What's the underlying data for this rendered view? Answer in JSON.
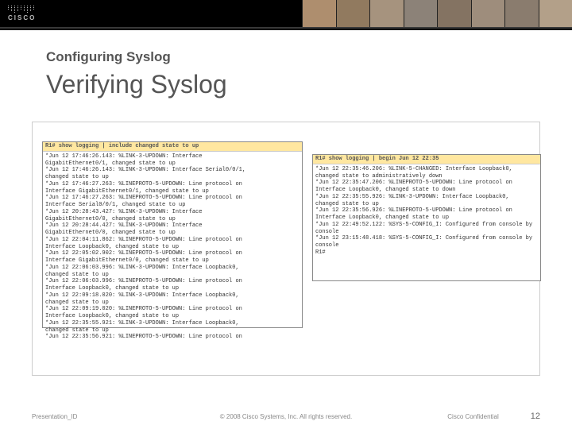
{
  "header": {
    "logo_text": "CISCO"
  },
  "heading": {
    "subtitle": "Configuring Syslog",
    "title": "Verifying Syslog"
  },
  "terminal_left": {
    "highlight": "R1# show logging | include changed state to up",
    "body": "*Jun 12 17:46:26.143: %LINK-3-UPDOWN: Interface\nGigabitEthernet0/1, changed state to up\n*Jun 12 17:46:26.143: %LINK-3-UPDOWN: Interface Serial0/0/1,\nchanged state to up\n*Jun 12 17:46:27.263: %LINEPROTO-5-UPDOWN: Line protocol on\nInterface GigabitEthernet0/1, changed state to up\n*Jun 12 17:46:27.263: %LINEPROTO-5-UPDOWN: Line protocol on\nInterface Serial0/0/1, changed state to up\n*Jun 12 20:28:43.427: %LINK-3-UPDOWN: Interface\nGigabitEthernet0/0, changed state to up\n*Jun 12 20:28:44.427: %LINK-3-UPDOWN: Interface\nGigabitEthernet0/0, changed state to up\n*Jun 12 22:04:11.862: %LINEPROTO-5-UPDOWN: Line protocol on\nInterface Loopback0, changed state to up\n*Jun 12 22:05:02.902: %LINEPROTO-5-UPDOWN: Line protocol on\nInterface GigabitEthernet0/0, changed state to up\n*Jun 12 22:06:03.996: %LINK-3-UPDOWN: Interface Loopback0,\nchanged state to up\n*Jun 12 22:06:03.996: %LINEPROTO-5-UPDOWN: Line protocol on\nInterface Loopback0, changed state to up\n*Jun 12 22:09:18.020: %LINK-3-UPDOWN: Interface Loopback0,\nchanged state to up\n*Jun 12 22:09:19.020: %LINEPROTO-5-UPDOWN: Line protocol on\nInterface Loopback0, changed state to up\n*Jun 12 22:35:55.921: %LINK-3-UPDOWN: Interface Loopback0,\nchanged state to up\n*Jun 12 22:35:56.921: %LINEPROTO-5-UPDOWN: Line protocol on"
  },
  "terminal_right": {
    "highlight": "R1# show logging | begin Jun 12 22:35",
    "body": "*Jun 12 22:35:46.206: %LINK-5-CHANGED: Interface Loopback0,\nchanged state to administratively down\n*Jun 12 22:35:47.206: %LINEPROTO-5-UPDOWN: Line protocol on\nInterface Loopback0, changed state to down\n*Jun 12 22:35:55.926: %LINK-3-UPDOWN: Interface Loopback0,\nchanged state to up\n*Jun 12 22:35:56.926: %LINEPROTO-5-UPDOWN: Line protocol on\nInterface Loopback0, changed state to up\n*Jun 12 22:49:52.122: %SYS-5-CONFIG_I: Configured from console by\nconsole\n*Jun 12 23:15:48.418: %SYS-5-CONFIG_I: Configured from console by\nconsole\nR1#"
  },
  "footer": {
    "left": "Presentation_ID",
    "center": "© 2008 Cisco Systems, Inc. All rights reserved.",
    "right": "Cisco Confidential",
    "page": "12"
  },
  "photostrip_colors": [
    "#ae8e6e",
    "#917a5f",
    "#a6937e",
    "#8c8278",
    "#847362",
    "#9e8d7c",
    "#8a7c6e",
    "#b3a089"
  ]
}
